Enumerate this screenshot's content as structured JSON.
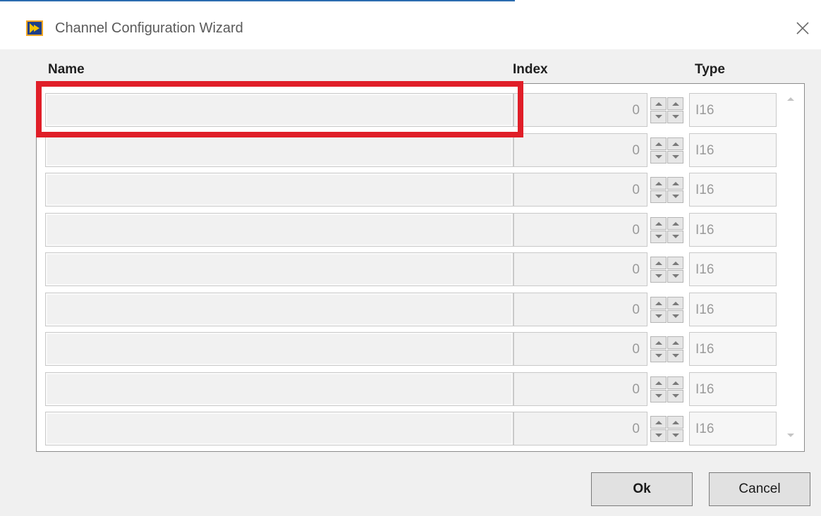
{
  "window": {
    "title": "Channel Configuration Wizard",
    "icon": "labview-icon",
    "close_icon": "close-icon"
  },
  "table": {
    "columns": [
      "Name",
      "Index",
      "Type"
    ],
    "rows": [
      {
        "name": "",
        "index": "0",
        "type": "I16"
      },
      {
        "name": "",
        "index": "0",
        "type": "I16"
      },
      {
        "name": "",
        "index": "0",
        "type": "I16"
      },
      {
        "name": "",
        "index": "0",
        "type": "I16"
      },
      {
        "name": "",
        "index": "0",
        "type": "I16"
      },
      {
        "name": "",
        "index": "0",
        "type": "I16"
      },
      {
        "name": "",
        "index": "0",
        "type": "I16"
      },
      {
        "name": "",
        "index": "0",
        "type": "I16"
      },
      {
        "name": "",
        "index": "0",
        "type": "I16"
      }
    ]
  },
  "buttons": {
    "ok": "Ok",
    "cancel": "Cancel"
  },
  "colors": {
    "highlight": "#e01e28",
    "accent": "#2b6cb0"
  }
}
